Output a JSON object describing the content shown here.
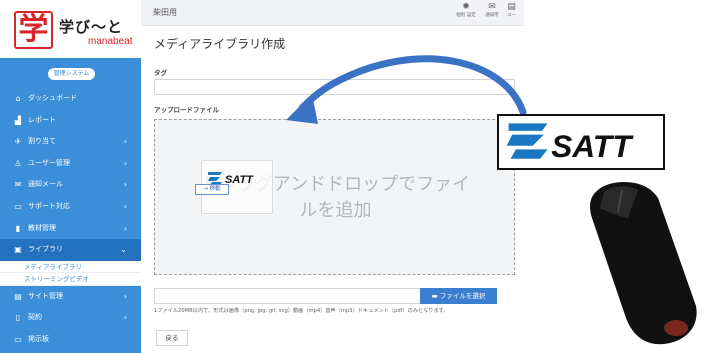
{
  "sidebar": {
    "logo": {
      "mark": "学",
      "text": "学び〜と",
      "sub": "manabeat"
    },
    "admin_label": "管理システム",
    "items": [
      {
        "icon": "home-icon",
        "glyph": "⌂",
        "label": "ダッシュボード",
        "has_children": false
      },
      {
        "icon": "chart-icon",
        "glyph": "▟",
        "label": "レポート",
        "has_children": false
      },
      {
        "icon": "pin-icon",
        "glyph": "✈",
        "label": "割り当て",
        "has_children": true
      },
      {
        "icon": "user-icon",
        "glyph": "♙",
        "label": "ユーザー管理",
        "has_children": true
      },
      {
        "icon": "mail-icon",
        "glyph": "✉",
        "label": "通知メール",
        "has_children": true
      },
      {
        "icon": "chat-icon",
        "glyph": "▭",
        "label": "サポート対応",
        "has_children": true
      },
      {
        "icon": "book-icon",
        "glyph": "▮",
        "label": "教材管理",
        "has_children": true
      },
      {
        "icon": "library-icon",
        "glyph": "▣",
        "label": "ライブラリ",
        "has_children": true,
        "expanded": true
      }
    ],
    "sub_items": [
      "メディアライブラリ",
      "ストリーミングビデオ"
    ],
    "items_after": [
      {
        "icon": "site-icon",
        "glyph": "▤",
        "label": "サイト管理",
        "has_children": true
      },
      {
        "icon": "contract-icon",
        "glyph": "▯",
        "label": "契約",
        "has_children": true
      },
      {
        "icon": "board-icon",
        "glyph": "▭",
        "label": "掲示板",
        "has_children": false
      }
    ]
  },
  "topbar": {
    "user": "柴田用",
    "icons": [
      {
        "name": "settings-icon",
        "glyph": "✹",
        "label": "個別 設定"
      },
      {
        "name": "mail-icon",
        "glyph": "✉",
        "label": "通知所"
      },
      {
        "name": "user-icon",
        "glyph": "▤",
        "label": "ユー"
      }
    ]
  },
  "main": {
    "title": "メディアライブラリ作成",
    "tag_label": "タグ",
    "tag_value": "",
    "upload_label": "アップロードファイル",
    "dropzone_line1": "ドラッグアンドドロップでファイ",
    "dropzone_line2": "ルを追加",
    "move_label": "→ 移動",
    "file_button": "ファイルを選択",
    "file_note": "1ファイル20MB以内で、形式は画像（png, jpg, gif, svg）動画（mp4）音声（mp3）ドキュメント（pdf）のみとなります。",
    "back_button": "戻る"
  },
  "overlay": {
    "logo_text": "SATT",
    "brand_color": "#1a78c2",
    "arrow_color": "#3a72c4"
  }
}
